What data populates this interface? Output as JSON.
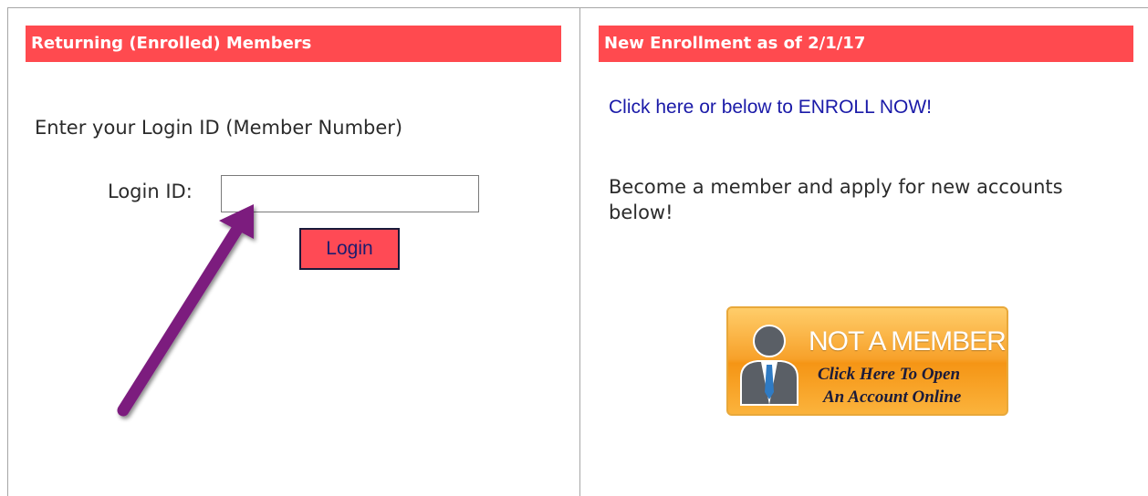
{
  "left_panel": {
    "header": "Returning (Enrolled) Members",
    "prompt": "Enter your Login ID (Member Number)",
    "login_label": "Login ID:",
    "login_value": "",
    "login_button": "Login"
  },
  "right_panel": {
    "header": "New Enrollment as of 2/1/17",
    "enroll_link": "Click here or below to ENROLL NOW!",
    "become_text": "Become a member and apply for new accounts below!",
    "badge": {
      "title": "NOT A MEMBER?",
      "line1": "Click Here To Open",
      "line2": "An Account Online"
    }
  },
  "colors": {
    "header_bg": "#ff4a4f",
    "button_bg": "#ff4a55",
    "link": "#1a1aa8",
    "arrow": "#7b1b7e",
    "badge_orange": "#f59515"
  },
  "icons": [
    "person-icon",
    "pointer-arrow-icon"
  ]
}
